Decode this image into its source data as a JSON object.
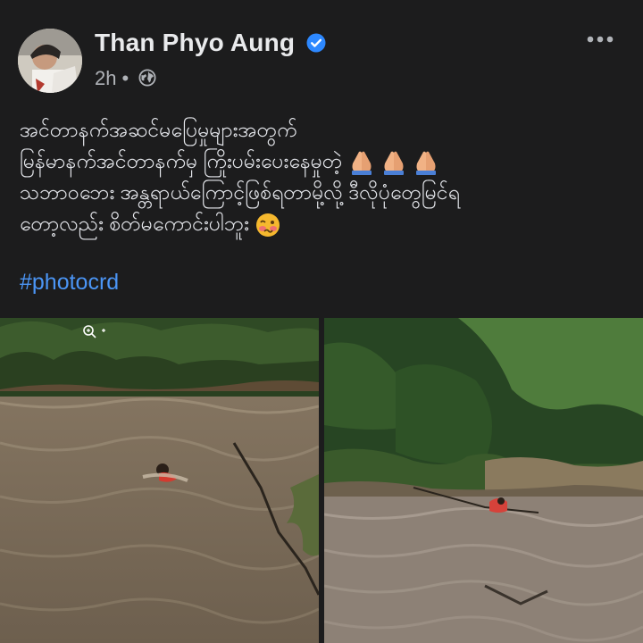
{
  "post": {
    "author_name": "Than Phyo Aung",
    "verified": true,
    "time": "2h",
    "separator": "•",
    "privacy_icon": "globe-icon",
    "more_icon": "more-horizontal-icon",
    "text_lines": [
      "အင်တာနက်အဆင်မပြေမှုများအတွက်",
      "မြန်မာနက်အင်တာနက်မှ ကြိုးပမ်းပေးနေမှုတဲ့",
      "သဘာဝဘေး အန္တရာယ်ကြောင့်ဖြစ်ရတာမို့လို့ ဒီလိုပုံတွေမြင်ရ",
      "တော့လည်း စိတ်မကောင်းပါဘူး"
    ],
    "emoji_line2": "pray-hands-emoji x3",
    "emoji_line4": "woozy-face-emoji",
    "hashtag": "#photocrd"
  },
  "photos": [
    {
      "description_icon": "zoom-in-icon",
      "name": "flood-rescue-photo-left"
    },
    {
      "name": "flood-rescue-photo-right"
    }
  ],
  "colors": {
    "background": "#1c1c1d",
    "text": "#e4e6eb",
    "secondary_text": "#b0b3b8",
    "link": "#4b95f5",
    "verified_badge": "#2d88ff"
  }
}
